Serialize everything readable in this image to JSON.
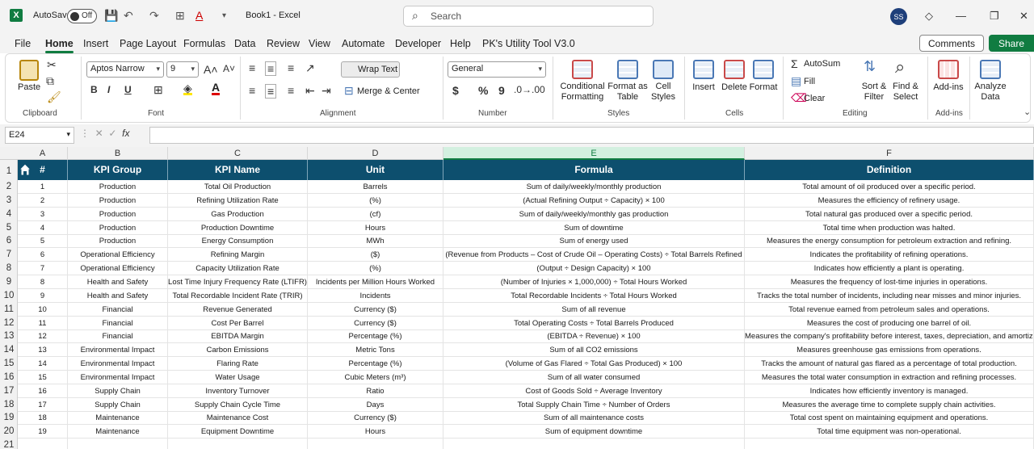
{
  "app": {
    "autosave_label": "AutoSave",
    "autosave_state": "Off",
    "doc_title": "Book1  -  Excel",
    "search_placeholder": "Search",
    "user_initials": "SS",
    "logo": "X"
  },
  "menu": {
    "tabs": [
      "File",
      "Home",
      "Insert",
      "Page Layout",
      "Formulas",
      "Data",
      "Review",
      "View",
      "Automate",
      "Developer",
      "Help",
      "PK's Utility Tool V3.0"
    ],
    "active": "Home",
    "comments": "Comments",
    "share": "Share"
  },
  "ribbon": {
    "clipboard": {
      "paste": "Paste",
      "label": "Clipboard"
    },
    "font": {
      "name": "Aptos Narrow",
      "size": "9",
      "label": "Font",
      "bold": "B",
      "italic": "I",
      "underline": "U"
    },
    "alignment": {
      "wrap": "Wrap Text",
      "merge": "Merge & Center",
      "label": "Alignment"
    },
    "number": {
      "format": "General",
      "label": "Number",
      "currency": "$",
      "percent": "%",
      "comma": "9"
    },
    "styles": {
      "cond": [
        "Conditional",
        "Formatting"
      ],
      "table": [
        "Format as",
        "Table"
      ],
      "cell": [
        "Cell",
        "Styles"
      ],
      "label": "Styles"
    },
    "cells": {
      "insert": "Insert",
      "delete": "Delete",
      "format": "Format",
      "label": "Cells"
    },
    "editing": {
      "autosum": "AutoSum",
      "fill": "Fill",
      "clear": "Clear",
      "sort": [
        "Sort &",
        "Filter"
      ],
      "find": [
        "Find &",
        "Select"
      ],
      "label": "Editing"
    },
    "addins": {
      "addins": "Add-ins",
      "label": "Add-ins",
      "analyze": [
        "Analyze",
        "Data"
      ]
    }
  },
  "formula_bar": {
    "name_box": "E24",
    "fx": "fx",
    "value": ""
  },
  "grid": {
    "columns": [
      "A",
      "B",
      "C",
      "D",
      "E",
      "F"
    ],
    "selected_column": "E",
    "row_numbers": [
      "1",
      "2",
      "3",
      "4",
      "5",
      "6",
      "7",
      "8",
      "9",
      "10",
      "11",
      "12",
      "13",
      "14",
      "15",
      "16",
      "17",
      "18",
      "19",
      "20",
      "21"
    ],
    "headers": [
      "#",
      "KPI Group",
      "KPI Name",
      "Unit",
      "Formula",
      "Definition"
    ],
    "header_bg": "#0d4f6e",
    "rows": [
      [
        "1",
        "Production",
        "Total Oil Production",
        "Barrels",
        "Sum of daily/weekly/monthly production",
        "Total amount of oil produced over a specific period."
      ],
      [
        "2",
        "Production",
        "Refining Utilization Rate",
        "(%)",
        "(Actual Refining Output ÷ Capacity) × 100",
        "Measures the efficiency of refinery usage."
      ],
      [
        "3",
        "Production",
        "Gas Production",
        "(cf)",
        "Sum of daily/weekly/monthly gas production",
        "Total natural gas produced over a specific period."
      ],
      [
        "4",
        "Production",
        "Production Downtime",
        "Hours",
        "Sum of downtime",
        "Total time when production was halted."
      ],
      [
        "5",
        "Production",
        "Energy Consumption",
        "MWh",
        "Sum of energy used",
        "Measures the energy consumption for petroleum extraction and refining."
      ],
      [
        "6",
        "Operational Efficiency",
        "Refining Margin",
        "($)",
        "(Revenue from Products – Cost of Crude Oil – Operating Costs) ÷ Total Barrels Refined",
        "Indicates the profitability of refining operations."
      ],
      [
        "7",
        "Operational Efficiency",
        "Capacity Utilization Rate",
        "(%)",
        "(Output ÷ Design Capacity) × 100",
        "Indicates how efficiently a plant is operating."
      ],
      [
        "8",
        "Health and Safety",
        "Lost Time Injury Frequency Rate (LTIFR)",
        "Incidents per Million Hours Worked",
        "(Number of Injuries × 1,000,000) ÷ Total Hours Worked",
        "Measures the frequency of lost-time injuries in operations."
      ],
      [
        "9",
        "Health and Safety",
        "Total Recordable Incident Rate (TRIR)",
        "Incidents",
        "Total Recordable Incidents ÷ Total Hours Worked",
        "Tracks the total number of incidents, including near misses and minor injuries."
      ],
      [
        "10",
        "Financial",
        "Revenue Generated",
        "Currency ($)",
        "Sum of all revenue",
        "Total revenue earned from petroleum sales and operations."
      ],
      [
        "11",
        "Financial",
        "Cost Per Barrel",
        "Currency ($)",
        "Total Operating Costs ÷ Total Barrels Produced",
        "Measures the cost of producing one barrel of oil."
      ],
      [
        "12",
        "Financial",
        "EBITDA Margin",
        "Percentage (%)",
        "(EBITDA ÷ Revenue) × 100",
        "Measures the company's profitability before interest, taxes, depreciation, and amortization."
      ],
      [
        "13",
        "Environmental Impact",
        "Carbon Emissions",
        "Metric Tons",
        "Sum of all CO2 emissions",
        "Measures greenhouse gas emissions from operations."
      ],
      [
        "14",
        "Environmental Impact",
        "Flaring Rate",
        "Percentage (%)",
        "(Volume of Gas Flared ÷ Total Gas Produced) × 100",
        "Tracks the amount of natural gas flared as a percentage of total production."
      ],
      [
        "15",
        "Environmental Impact",
        "Water Usage",
        "Cubic Meters (m³)",
        "Sum of all water consumed",
        "Measures the total water consumption in extraction and refining processes."
      ],
      [
        "16",
        "Supply Chain",
        "Inventory Turnover",
        "Ratio",
        "Cost of Goods Sold ÷ Average Inventory",
        "Indicates how efficiently inventory is managed."
      ],
      [
        "17",
        "Supply Chain",
        "Supply Chain Cycle Time",
        "Days",
        "Total Supply Chain Time ÷ Number of Orders",
        "Measures the average time to complete supply chain activities."
      ],
      [
        "18",
        "Maintenance",
        "Maintenance Cost",
        "Currency ($)",
        "Sum of all maintenance costs",
        "Total cost spent on maintaining equipment and operations."
      ],
      [
        "19",
        "Maintenance",
        "Equipment Downtime",
        "Hours",
        "Sum of equipment downtime",
        "Total time equipment was non-operational."
      ]
    ]
  }
}
